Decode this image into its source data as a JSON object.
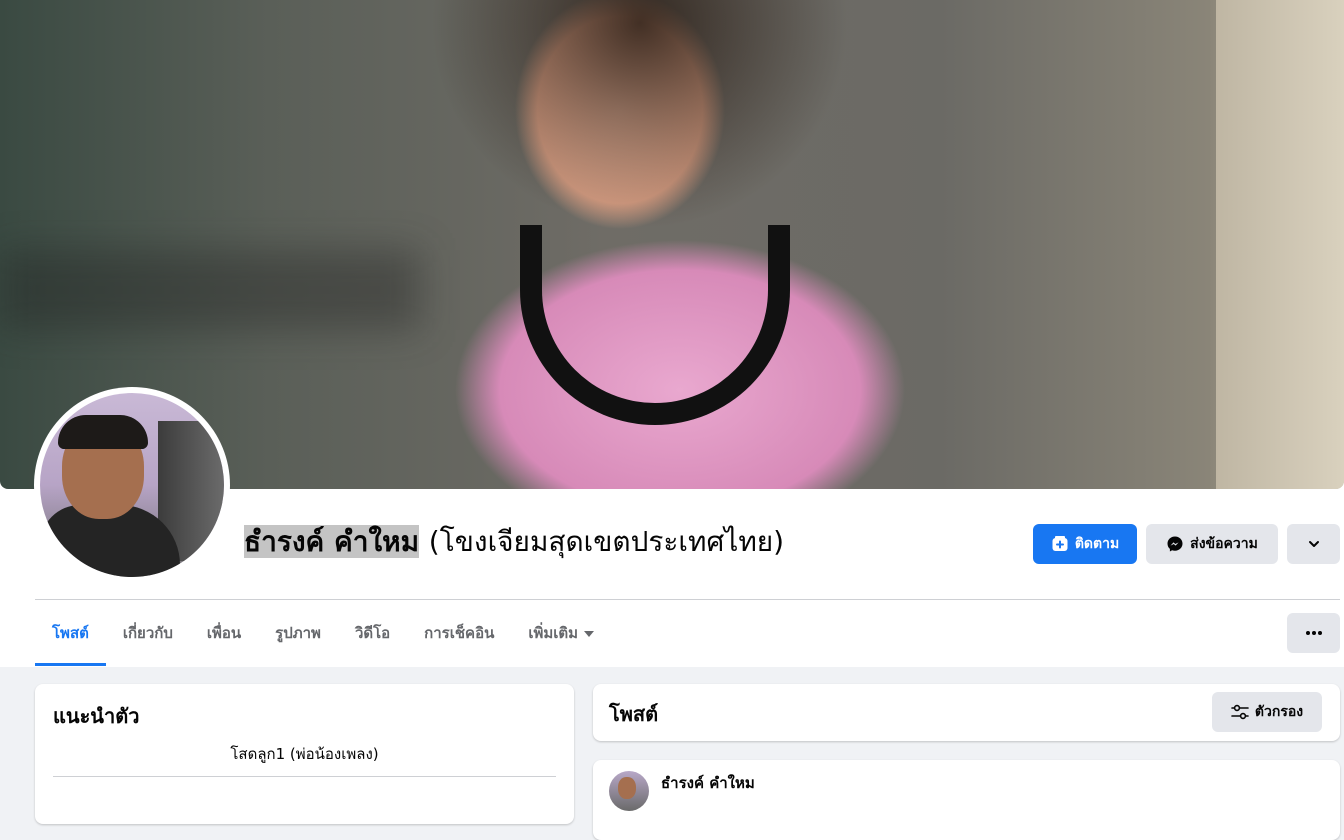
{
  "profile": {
    "name": "ธำรงค์ คำใหม",
    "alternate_name": "(โขงเจียมสุดเขตประเทศไทย)"
  },
  "actions": {
    "follow_label": "ติดตาม",
    "message_label": "ส่งข้อความ"
  },
  "tabs": [
    {
      "label": "โพสต์",
      "active": true
    },
    {
      "label": "เกี่ยวกับ",
      "active": false
    },
    {
      "label": "เพื่อน",
      "active": false
    },
    {
      "label": "รูปภาพ",
      "active": false
    },
    {
      "label": "วิดีโอ",
      "active": false
    },
    {
      "label": "การเช็คอิน",
      "active": false
    },
    {
      "label": "เพิ่มเติม",
      "active": false
    }
  ],
  "intro": {
    "title": "แนะนำตัว",
    "bio": "โสดลูก1 (พ่อน้องเพลง)"
  },
  "posts": {
    "title": "โพสต์",
    "filter_label": "ตัวกรอง",
    "first_post_author": "ธำรงค์ คำใหม"
  },
  "colors": {
    "accent": "#1877f2",
    "button_gray": "#e4e6eb",
    "page_bg": "#f0f2f5"
  },
  "icons": {
    "follow": "follow-plus-icon",
    "message": "messenger-icon",
    "more": "chevron-down-icon",
    "tab_menu": "more-dots-icon",
    "filter": "filter-sliders-icon"
  }
}
